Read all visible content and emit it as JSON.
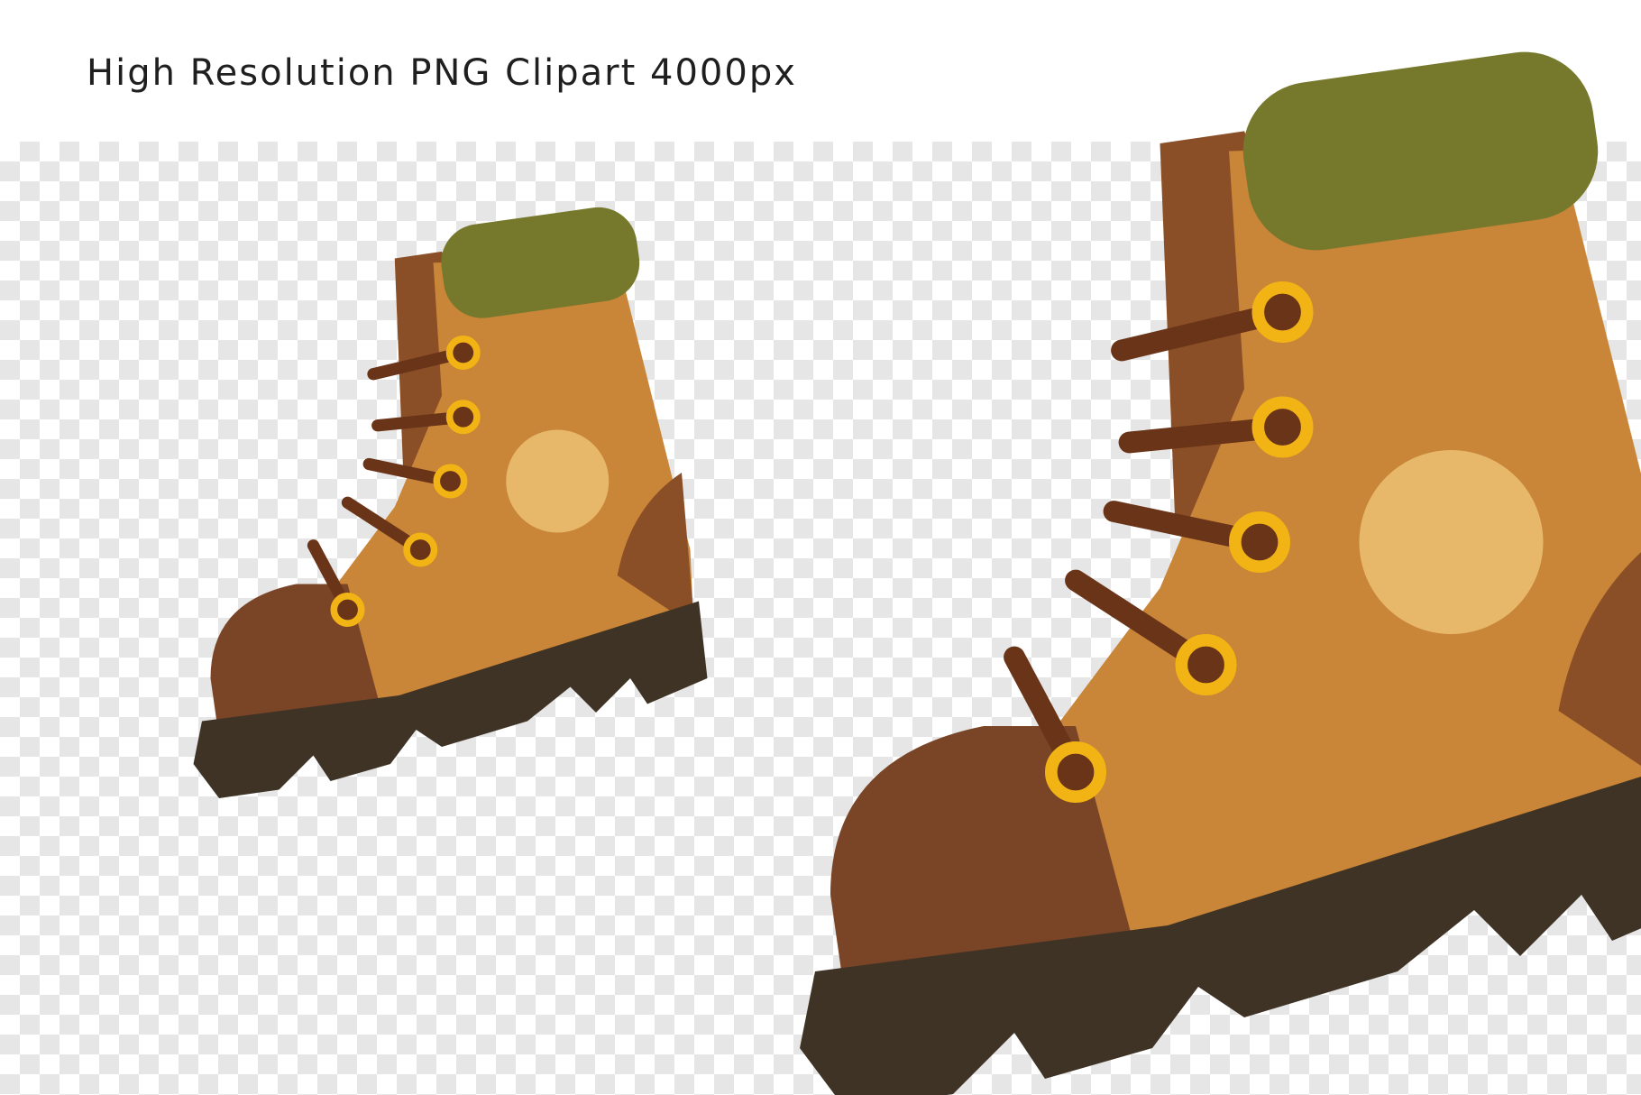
{
  "headline": "High Resolution PNG Clipart 4000px",
  "illustration": {
    "subject": "hiking-boot-icon",
    "colors": {
      "leather": "#C98538",
      "leather_shade": "#B06F2A",
      "heel_tab": "#8A4F26",
      "toe_cap": "#7A4426",
      "collar": "#76792B",
      "sole": "#3F3326",
      "patch": "#E8B86A",
      "eyelet": "#F2B315",
      "lace": "#6A3418"
    }
  }
}
